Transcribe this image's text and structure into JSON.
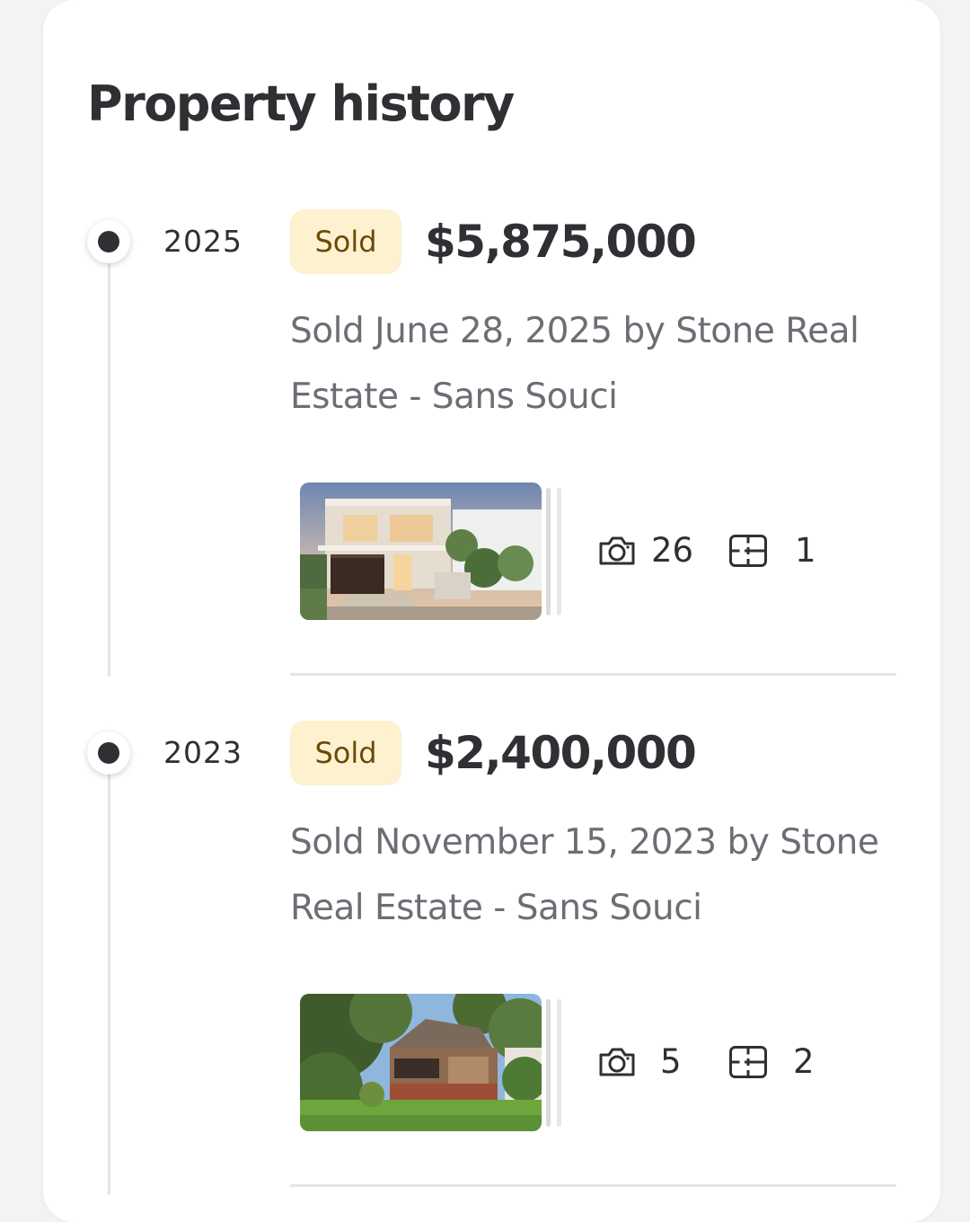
{
  "section": {
    "title": "Property history"
  },
  "history": [
    {
      "year": "2025",
      "badge": "Sold",
      "price": "$5,875,000",
      "description": "Sold June 28, 2025 by Stone Real Estate - Sans Souci",
      "photos_count": "26",
      "floorplans_count": "1",
      "thumbnail_alt": "Modern two-storey white house with dark garage door"
    },
    {
      "year": "2023",
      "badge": "Sold",
      "price": "$2,400,000",
      "description": "Sold November 15, 2023 by Stone Real Estate - Sans Souci",
      "photos_count": "5",
      "floorplans_count": "2",
      "thumbnail_alt": "Older brick house surrounded by trees"
    }
  ],
  "icons": {
    "photos": "camera-icon",
    "floorplans": "floorplan-icon"
  },
  "colors": {
    "badge_bg": "#fdf1cf",
    "badge_text": "#6b4a05",
    "text_primary": "#2e3033",
    "text_secondary": "#6b6e74"
  }
}
